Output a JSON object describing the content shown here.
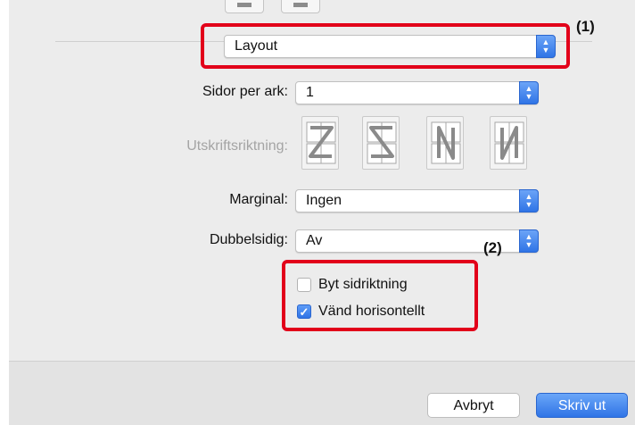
{
  "callouts": {
    "one": "(1)",
    "two": "(2)"
  },
  "section_popup": {
    "value": "Layout"
  },
  "pages_per_sheet": {
    "label": "Sidor per ark:",
    "value": "1"
  },
  "orientation": {
    "label": "Utskriftsriktning:",
    "options": [
      "Z",
      "S",
      "N-reversed",
      "N"
    ]
  },
  "margin": {
    "label": "Marginal:",
    "value": "Ingen"
  },
  "duplex": {
    "label": "Dubbelsidig:",
    "value": "Av"
  },
  "options": {
    "flip_direction": {
      "label": "Byt sidriktning",
      "checked": false
    },
    "flip_horizontal": {
      "label": "Vänd horisontellt",
      "checked": true
    }
  },
  "buttons": {
    "cancel": "Avbryt",
    "print": "Skriv ut"
  },
  "colors": {
    "accent": "#2f74e6",
    "highlight": "#e2001a"
  }
}
